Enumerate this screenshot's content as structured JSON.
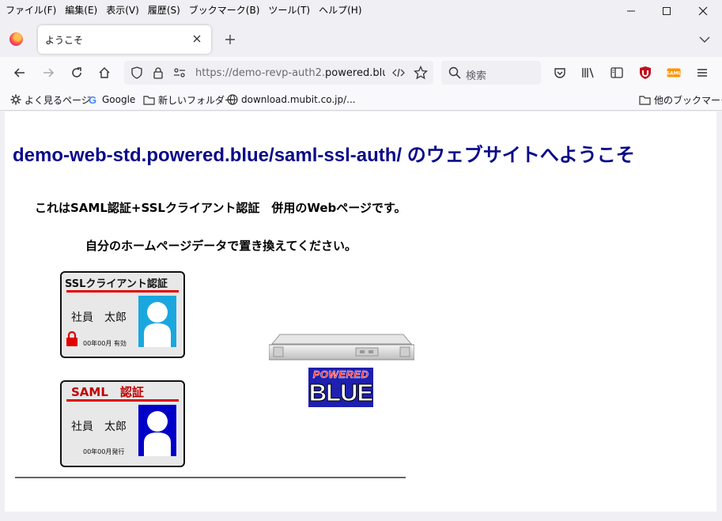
{
  "menu": [
    "ファイル(F)",
    "編集(E)",
    "表示(V)",
    "履歴(S)",
    "ブックマーク(B)",
    "ツール(T)",
    "ヘルプ(H)"
  ],
  "tab": {
    "title": "ようこそ"
  },
  "url": {
    "prefix": "https://demo-revp-auth2.",
    "host": "powered.blue",
    "rest": "/"
  },
  "search": {
    "placeholder": "検索"
  },
  "bookmarks": {
    "most_visited": "よく見るページ",
    "google": "Google",
    "new_folder": "新しいフォルダー",
    "download": "download.mubit.co.jp/...",
    "other": "他のブックマーク"
  },
  "page": {
    "title": "demo-web-std.powered.blue/saml-ssl-auth/ のウェブサイトへようこそ",
    "line1": "これはSAML認証+SSLクライアント認証　併用のWebページです。",
    "line2": "自分のホームページデータで置き換えてください。"
  },
  "ssl_card": {
    "heading": "SSLクライアント認証",
    "name": "社員　太郎",
    "date": "00年00月 有効",
    "photo_color": "#1aa7e0"
  },
  "saml_card": {
    "heading": "SAML　認証",
    "name": "社員　太郎",
    "date": "00年00月発行",
    "photo_color": "#0000c8"
  },
  "logo": {
    "top": "POWERED",
    "bottom": "BLUE"
  },
  "colors": {
    "title": "#0a0a8a",
    "accent_red": "#e00000"
  }
}
